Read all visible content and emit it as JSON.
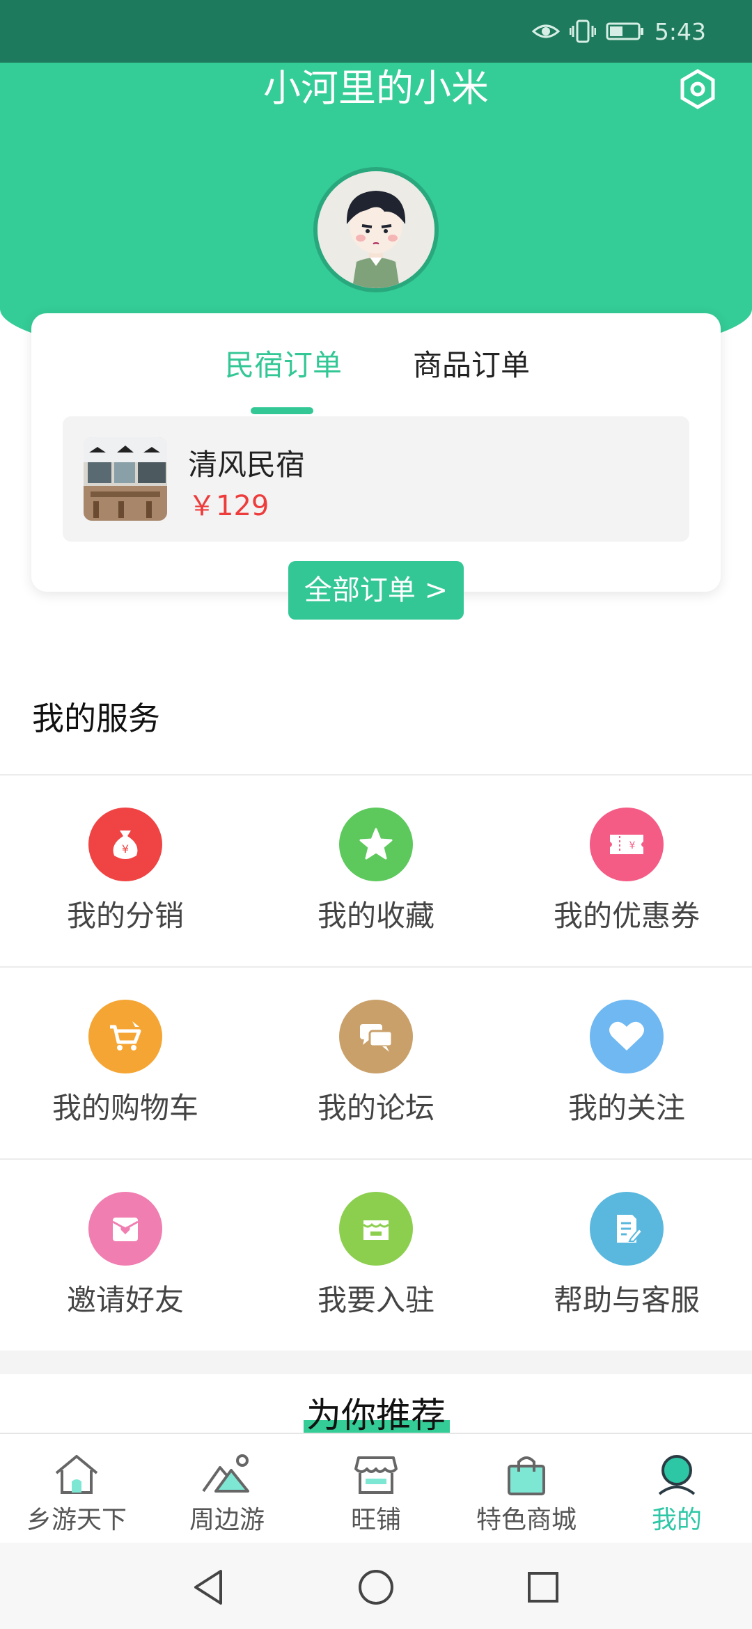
{
  "status_bar": {
    "time": "5:43"
  },
  "header": {
    "title": "小河里的小米"
  },
  "orders": {
    "tabs": [
      {
        "label": "民宿订单",
        "active": true
      },
      {
        "label": "商品订单",
        "active": false
      }
    ],
    "item": {
      "name": "清风民宿",
      "price": "￥129"
    },
    "all_orders_label": "全部订单 >"
  },
  "services": {
    "title": "我的服务",
    "items": [
      {
        "label": "我的分销",
        "icon": "money-bag-icon",
        "color": "#f04444"
      },
      {
        "label": "我的收藏",
        "icon": "star-icon",
        "color": "#5dc95d"
      },
      {
        "label": "我的优惠券",
        "icon": "coupon-icon",
        "color": "#f45b85"
      },
      {
        "label": "我的购物车",
        "icon": "cart-icon",
        "color": "#f5a533"
      },
      {
        "label": "我的论坛",
        "icon": "chat-icon",
        "color": "#c9a06a"
      },
      {
        "label": "我的关注",
        "icon": "heart-icon",
        "color": "#6fb8f2"
      },
      {
        "label": "邀请好友",
        "icon": "invite-icon",
        "color": "#f07eb1"
      },
      {
        "label": "我要入驻",
        "icon": "store-icon",
        "color": "#8ccf4f"
      },
      {
        "label": "帮助与客服",
        "icon": "help-doc-icon",
        "color": "#5ab8de"
      }
    ]
  },
  "recommend": {
    "title": "为你推荐"
  },
  "bottom_nav": {
    "items": [
      {
        "label": "乡游天下",
        "icon": "home-icon"
      },
      {
        "label": "周边游",
        "icon": "mountain-icon"
      },
      {
        "label": "旺铺",
        "icon": "shop-icon"
      },
      {
        "label": "特色商城",
        "icon": "shopping-bag-icon"
      },
      {
        "label": "我的",
        "icon": "profile-icon",
        "active": true
      }
    ]
  },
  "colors": {
    "brand": "#34cc97",
    "status_bar": "#1e7a5c",
    "price": "#ee3b3b",
    "nav_active": "#2dc7a6"
  }
}
